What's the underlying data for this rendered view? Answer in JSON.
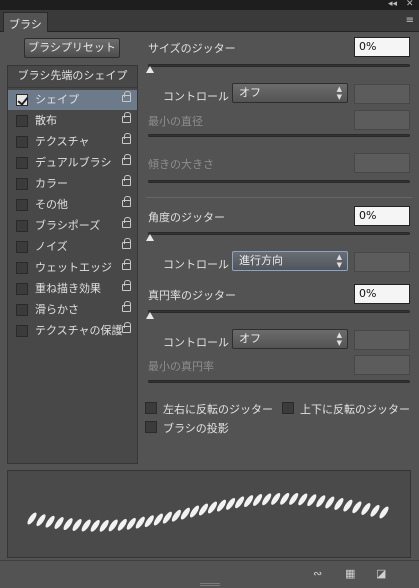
{
  "window": {
    "collapse_icon": "◂◂",
    "close_icon": "✕"
  },
  "tab": {
    "label": "ブラシ"
  },
  "panel_menu_icon": "≡",
  "preset_button": "ブラシプリセット",
  "left_list": {
    "header": "ブラシ先端のシェイプ",
    "items": [
      {
        "label": "シェイプ",
        "checked": true,
        "selected": true
      },
      {
        "label": "散布",
        "checked": false
      },
      {
        "label": "テクスチャ",
        "checked": false
      },
      {
        "label": "デュアルブラシ",
        "checked": false
      },
      {
        "label": "カラー",
        "checked": false
      },
      {
        "label": "その他",
        "checked": false
      },
      {
        "label": "ブラシポーズ",
        "checked": false
      },
      {
        "label": "ノイズ",
        "checked": false
      },
      {
        "label": "ウェットエッジ",
        "checked": false
      },
      {
        "label": "重ね描き効果",
        "checked": false
      },
      {
        "label": "滑らかさ",
        "checked": false
      },
      {
        "label": "テクスチャの保護",
        "checked": false
      }
    ]
  },
  "size_jitter": {
    "label": "サイズのジッター",
    "value": "0%"
  },
  "control1": {
    "label": "コントロール :",
    "value": "オフ"
  },
  "min_diameter": {
    "label": "最小の直径"
  },
  "tilt_scale": {
    "label": "傾きの大きさ"
  },
  "angle_jitter": {
    "label": "角度のジッター",
    "value": "0%"
  },
  "control2": {
    "label": "コントロール :",
    "value": "進行方向"
  },
  "roundness_jitter": {
    "label": "真円率のジッター",
    "value": "0%"
  },
  "control3": {
    "label": "コントロール :",
    "value": "オフ"
  },
  "min_roundness": {
    "label": "最小の真円率"
  },
  "flip_x": {
    "label": "左右に反転のジッター",
    "checked": false
  },
  "flip_y": {
    "label": "上下に反転のジッター",
    "checked": false
  },
  "brush_projection": {
    "label": "ブラシの投影",
    "checked": false
  },
  "colors": {
    "panel": "#535353",
    "selected_row": "#6d7a89",
    "field": "#f5f5f5"
  }
}
